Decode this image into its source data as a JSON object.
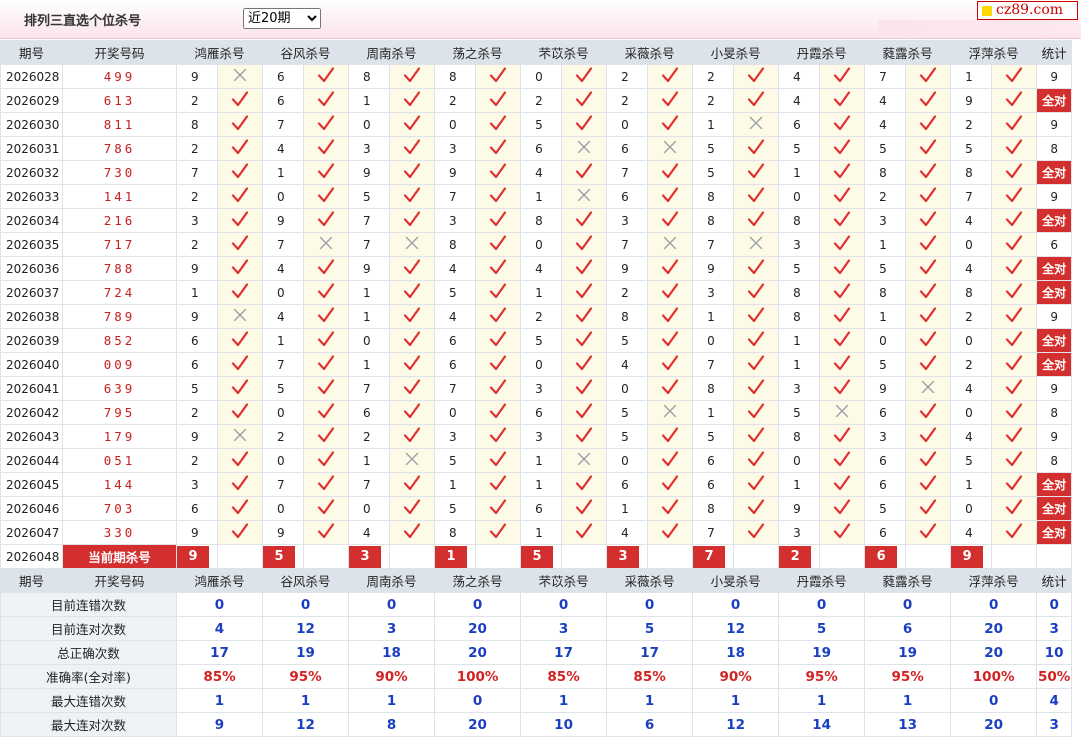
{
  "header": {
    "title": "排列三直选个位杀号",
    "period_select": {
      "selected": "近20期",
      "options": [
        "近20期"
      ]
    },
    "brand": "cz89.com"
  },
  "columns": {
    "period": "期号",
    "winning": "开奖号码",
    "experts": [
      "鸿雁杀号",
      "谷风杀号",
      "周南杀号",
      "荡之杀号",
      "芣苡杀号",
      "采薇杀号",
      "小旻杀号",
      "丹霞杀号",
      "蕤露杀号",
      "浮萍杀号"
    ],
    "stats": "统计"
  },
  "rows": [
    {
      "period": "2026028",
      "winning": "499",
      "kills": [
        [
          9,
          0
        ],
        [
          6,
          1
        ],
        [
          8,
          1
        ],
        [
          8,
          1
        ],
        [
          0,
          1
        ],
        [
          2,
          1
        ],
        [
          2,
          1
        ],
        [
          4,
          1
        ],
        [
          7,
          1
        ],
        [
          1,
          1
        ]
      ],
      "stat": "9"
    },
    {
      "period": "2026029",
      "winning": "613",
      "kills": [
        [
          2,
          1
        ],
        [
          6,
          1
        ],
        [
          1,
          1
        ],
        [
          2,
          1
        ],
        [
          2,
          1
        ],
        [
          2,
          1
        ],
        [
          2,
          1
        ],
        [
          4,
          1
        ],
        [
          4,
          1
        ],
        [
          9,
          1
        ]
      ],
      "stat": "全对"
    },
    {
      "period": "2026030",
      "winning": "811",
      "kills": [
        [
          8,
          1
        ],
        [
          7,
          1
        ],
        [
          0,
          1
        ],
        [
          0,
          1
        ],
        [
          5,
          1
        ],
        [
          0,
          1
        ],
        [
          1,
          0
        ],
        [
          6,
          1
        ],
        [
          4,
          1
        ],
        [
          2,
          1
        ]
      ],
      "stat": "9"
    },
    {
      "period": "2026031",
      "winning": "786",
      "kills": [
        [
          2,
          1
        ],
        [
          4,
          1
        ],
        [
          3,
          1
        ],
        [
          3,
          1
        ],
        [
          6,
          0
        ],
        [
          6,
          0
        ],
        [
          5,
          1
        ],
        [
          5,
          1
        ],
        [
          5,
          1
        ],
        [
          5,
          1
        ]
      ],
      "stat": "8"
    },
    {
      "period": "2026032",
      "winning": "730",
      "kills": [
        [
          7,
          1
        ],
        [
          1,
          1
        ],
        [
          9,
          1
        ],
        [
          9,
          1
        ],
        [
          4,
          1
        ],
        [
          7,
          1
        ],
        [
          5,
          1
        ],
        [
          1,
          1
        ],
        [
          8,
          1
        ],
        [
          8,
          1
        ]
      ],
      "stat": "全对"
    },
    {
      "period": "2026033",
      "winning": "141",
      "kills": [
        [
          2,
          1
        ],
        [
          0,
          1
        ],
        [
          5,
          1
        ],
        [
          7,
          1
        ],
        [
          1,
          0
        ],
        [
          6,
          1
        ],
        [
          8,
          1
        ],
        [
          0,
          1
        ],
        [
          2,
          1
        ],
        [
          7,
          1
        ]
      ],
      "stat": "9"
    },
    {
      "period": "2026034",
      "winning": "216",
      "kills": [
        [
          3,
          1
        ],
        [
          9,
          1
        ],
        [
          7,
          1
        ],
        [
          3,
          1
        ],
        [
          8,
          1
        ],
        [
          3,
          1
        ],
        [
          8,
          1
        ],
        [
          8,
          1
        ],
        [
          3,
          1
        ],
        [
          4,
          1
        ]
      ],
      "stat": "全对"
    },
    {
      "period": "2026035",
      "winning": "717",
      "kills": [
        [
          2,
          1
        ],
        [
          7,
          0
        ],
        [
          7,
          0
        ],
        [
          8,
          1
        ],
        [
          0,
          1
        ],
        [
          7,
          0
        ],
        [
          7,
          0
        ],
        [
          3,
          1
        ],
        [
          1,
          1
        ],
        [
          0,
          1
        ]
      ],
      "stat": "6"
    },
    {
      "period": "2026036",
      "winning": "788",
      "kills": [
        [
          9,
          1
        ],
        [
          4,
          1
        ],
        [
          9,
          1
        ],
        [
          4,
          1
        ],
        [
          4,
          1
        ],
        [
          9,
          1
        ],
        [
          9,
          1
        ],
        [
          5,
          1
        ],
        [
          5,
          1
        ],
        [
          4,
          1
        ]
      ],
      "stat": "全对"
    },
    {
      "period": "2026037",
      "winning": "724",
      "kills": [
        [
          1,
          1
        ],
        [
          0,
          1
        ],
        [
          1,
          1
        ],
        [
          5,
          1
        ],
        [
          1,
          1
        ],
        [
          2,
          1
        ],
        [
          3,
          1
        ],
        [
          8,
          1
        ],
        [
          8,
          1
        ],
        [
          8,
          1
        ]
      ],
      "stat": "全对"
    },
    {
      "period": "2026038",
      "winning": "789",
      "kills": [
        [
          9,
          0
        ],
        [
          4,
          1
        ],
        [
          1,
          1
        ],
        [
          4,
          1
        ],
        [
          2,
          1
        ],
        [
          8,
          1
        ],
        [
          1,
          1
        ],
        [
          8,
          1
        ],
        [
          1,
          1
        ],
        [
          2,
          1
        ]
      ],
      "stat": "9"
    },
    {
      "period": "2026039",
      "winning": "852",
      "kills": [
        [
          6,
          1
        ],
        [
          1,
          1
        ],
        [
          0,
          1
        ],
        [
          6,
          1
        ],
        [
          5,
          1
        ],
        [
          5,
          1
        ],
        [
          0,
          1
        ],
        [
          1,
          1
        ],
        [
          0,
          1
        ],
        [
          0,
          1
        ]
      ],
      "stat": "全对"
    },
    {
      "period": "2026040",
      "winning": "009",
      "kills": [
        [
          6,
          1
        ],
        [
          7,
          1
        ],
        [
          1,
          1
        ],
        [
          6,
          1
        ],
        [
          0,
          1
        ],
        [
          4,
          1
        ],
        [
          7,
          1
        ],
        [
          1,
          1
        ],
        [
          5,
          1
        ],
        [
          2,
          1
        ]
      ],
      "stat": "全对"
    },
    {
      "period": "2026041",
      "winning": "639",
      "kills": [
        [
          5,
          1
        ],
        [
          5,
          1
        ],
        [
          7,
          1
        ],
        [
          7,
          1
        ],
        [
          3,
          1
        ],
        [
          0,
          1
        ],
        [
          8,
          1
        ],
        [
          3,
          1
        ],
        [
          9,
          0
        ],
        [
          4,
          1
        ]
      ],
      "stat": "9"
    },
    {
      "period": "2026042",
      "winning": "795",
      "kills": [
        [
          2,
          1
        ],
        [
          0,
          1
        ],
        [
          6,
          1
        ],
        [
          0,
          1
        ],
        [
          6,
          1
        ],
        [
          5,
          0
        ],
        [
          1,
          1
        ],
        [
          5,
          0
        ],
        [
          6,
          1
        ],
        [
          0,
          1
        ]
      ],
      "stat": "8"
    },
    {
      "period": "2026043",
      "winning": "179",
      "kills": [
        [
          9,
          0
        ],
        [
          2,
          1
        ],
        [
          2,
          1
        ],
        [
          3,
          1
        ],
        [
          3,
          1
        ],
        [
          5,
          1
        ],
        [
          5,
          1
        ],
        [
          8,
          1
        ],
        [
          3,
          1
        ],
        [
          4,
          1
        ]
      ],
      "stat": "9"
    },
    {
      "period": "2026044",
      "winning": "051",
      "kills": [
        [
          2,
          1
        ],
        [
          0,
          1
        ],
        [
          1,
          0
        ],
        [
          5,
          1
        ],
        [
          1,
          0
        ],
        [
          0,
          1
        ],
        [
          6,
          1
        ],
        [
          0,
          1
        ],
        [
          6,
          1
        ],
        [
          5,
          1
        ]
      ],
      "stat": "8"
    },
    {
      "period": "2026045",
      "winning": "144",
      "kills": [
        [
          3,
          1
        ],
        [
          7,
          1
        ],
        [
          7,
          1
        ],
        [
          1,
          1
        ],
        [
          1,
          1
        ],
        [
          6,
          1
        ],
        [
          6,
          1
        ],
        [
          1,
          1
        ],
        [
          6,
          1
        ],
        [
          1,
          1
        ]
      ],
      "stat": "全对"
    },
    {
      "period": "2026046",
      "winning": "703",
      "kills": [
        [
          6,
          1
        ],
        [
          0,
          1
        ],
        [
          0,
          1
        ],
        [
          5,
          1
        ],
        [
          6,
          1
        ],
        [
          1,
          1
        ],
        [
          8,
          1
        ],
        [
          9,
          1
        ],
        [
          5,
          1
        ],
        [
          0,
          1
        ]
      ],
      "stat": "全对"
    },
    {
      "period": "2026047",
      "winning": "330",
      "kills": [
        [
          9,
          1
        ],
        [
          9,
          1
        ],
        [
          4,
          1
        ],
        [
          8,
          1
        ],
        [
          1,
          1
        ],
        [
          4,
          1
        ],
        [
          7,
          1
        ],
        [
          3,
          1
        ],
        [
          6,
          1
        ],
        [
          4,
          1
        ]
      ],
      "stat": "全对"
    }
  ],
  "current": {
    "period": "2026048",
    "label": "当前期杀号",
    "kills": [
      "9",
      "5",
      "3",
      "1",
      "5",
      "3",
      "7",
      "2",
      "6",
      "9"
    ]
  },
  "stats_rows": [
    {
      "label": "目前连错次数",
      "values": [
        "0",
        "0",
        "0",
        "0",
        "0",
        "0",
        "0",
        "0",
        "0",
        "0",
        "0"
      ],
      "red": false
    },
    {
      "label": "目前连对次数",
      "values": [
        "4",
        "12",
        "3",
        "20",
        "3",
        "5",
        "12",
        "5",
        "6",
        "20",
        "3"
      ],
      "red": false
    },
    {
      "label": "总正确次数",
      "values": [
        "17",
        "19",
        "18",
        "20",
        "17",
        "17",
        "18",
        "19",
        "19",
        "20",
        "10"
      ],
      "red": false
    },
    {
      "label": "准确率(全对率)",
      "values": [
        "85%",
        "95%",
        "90%",
        "100%",
        "85%",
        "85%",
        "90%",
        "95%",
        "95%",
        "100%",
        "50%"
      ],
      "red": true
    },
    {
      "label": "最大连错次数",
      "values": [
        "1",
        "1",
        "1",
        "0",
        "1",
        "1",
        "1",
        "1",
        "1",
        "0",
        "4"
      ],
      "red": false
    },
    {
      "label": "最大连对次数",
      "values": [
        "9",
        "12",
        "8",
        "20",
        "10",
        "6",
        "12",
        "14",
        "13",
        "20",
        "3"
      ],
      "red": false
    }
  ],
  "colors": {
    "accent_red": "#d32f2f",
    "stat_blue": "#1a3fc0",
    "header_bg": "#dde3ea",
    "mark_bg": "#fdfbe8"
  }
}
